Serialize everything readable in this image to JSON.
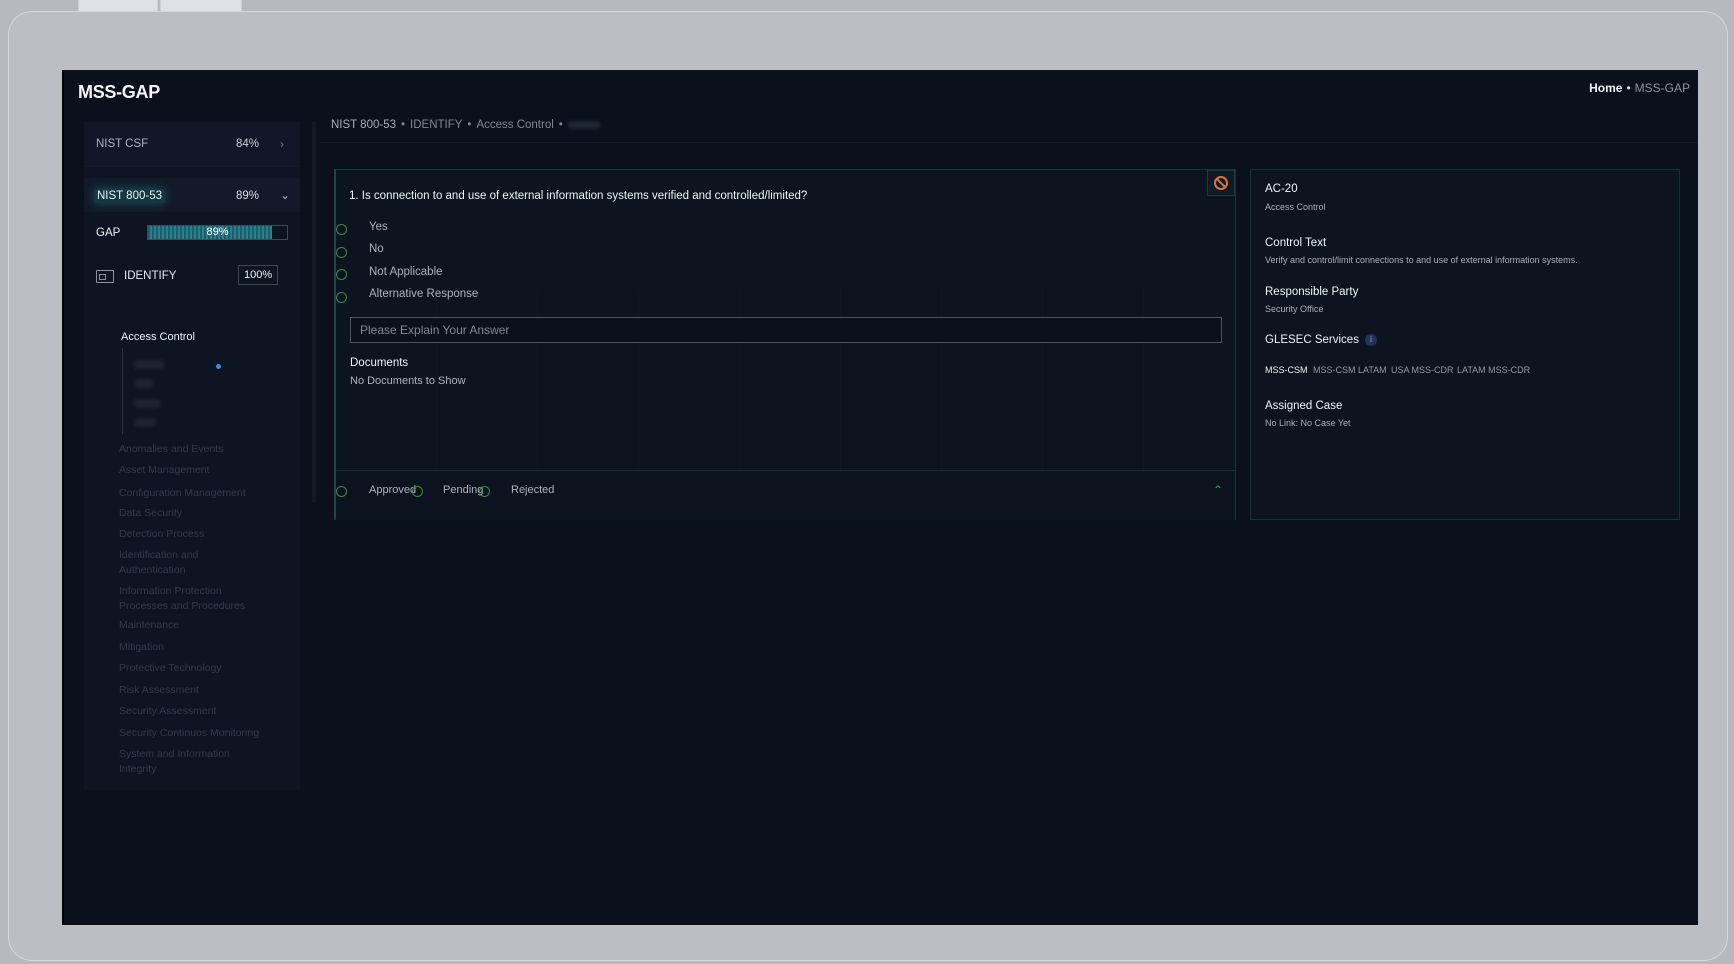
{
  "app": {
    "title": "MSS-GAP"
  },
  "top_breadcrumb": {
    "home": "Home",
    "sep": "•",
    "current": "MSS-GAP"
  },
  "sidebar": {
    "nist_csf": {
      "label": "NIST CSF",
      "percent": "84%",
      "chevron": "›"
    },
    "nist_800": {
      "label": "NIST 800-53",
      "percent": "89%",
      "chevron": "⌄"
    },
    "gap": {
      "label": "GAP",
      "percent": "89%",
      "fill": 0.89
    },
    "identify": {
      "label": "IDENTIFY",
      "percent": "100%"
    },
    "active_category": "Access Control",
    "categories": [
      "Anomalies and Events",
      "Asset Management",
      "Configuration Management",
      "Data Security",
      "Detection Process",
      "Identification and Authentication",
      "Information Protection Processes and Procedures",
      "Maintenance",
      "Mitigation",
      "Protective Technology",
      "Risk Assessment",
      "Security Assessment",
      "Security Continuos Monitoring",
      "System and Information Integrity"
    ]
  },
  "main_breadcrumb": {
    "items": [
      "NIST 800-53",
      "IDENTIFY",
      "Access Control"
    ],
    "sep": "•"
  },
  "question": {
    "text": "1. Is connection to and use of external information systems verified and controlled/limited?",
    "options": [
      "Yes",
      "No",
      "Not Applicable",
      "Alternative Response"
    ],
    "explain_placeholder": "Please Explain Your Answer",
    "documents_title": "Documents",
    "documents_empty": "No Documents to Show",
    "statuses": [
      "Approved",
      "Pending",
      "Rejected"
    ]
  },
  "details": {
    "control_id": "AC-20",
    "control_family": "Access Control",
    "control_text_title": "Control Text",
    "control_text": "Verify and control/limit connections to and use of external information systems.",
    "responsible_title": "Responsible Party",
    "responsible": "Security Office",
    "services_title": "GLESEC Services",
    "services_info": "i",
    "services": [
      "MSS-CSM",
      "MSS-CSM LATAM",
      "USA MSS-CDR",
      "LATAM MSS-CDR"
    ],
    "case_title": "Assigned Case",
    "case_value": "No Link: No Case Yet"
  },
  "colors": {
    "accent_green": "#3b8b3f",
    "ban_orange": "#d8763a",
    "selected_dot": "#2e8cf0"
  }
}
